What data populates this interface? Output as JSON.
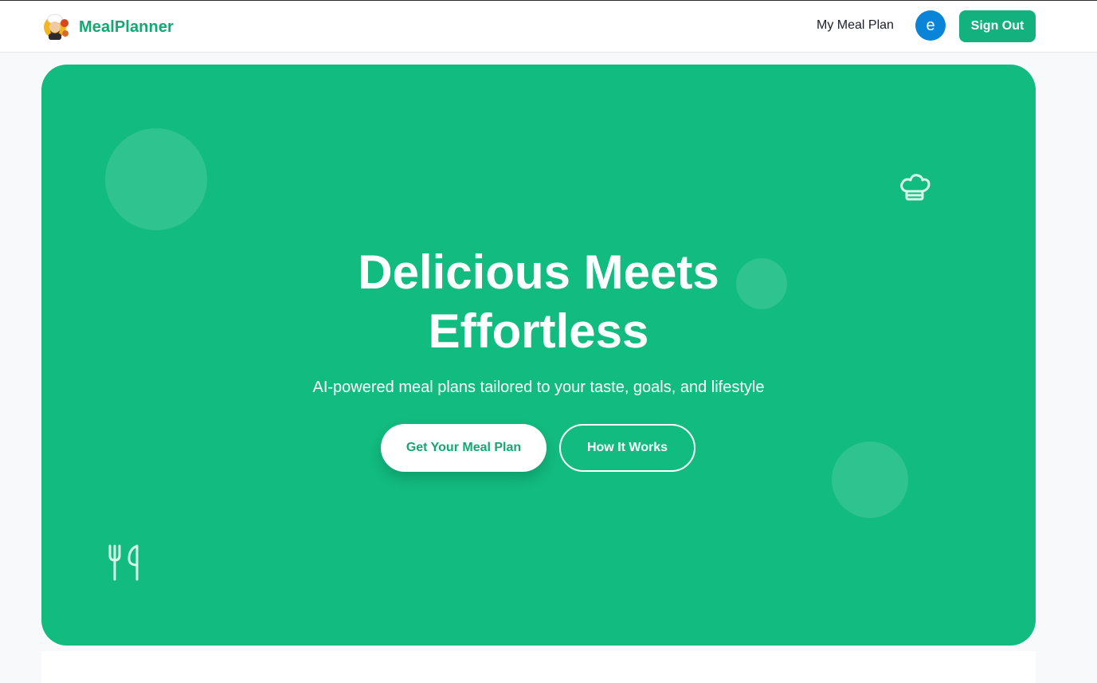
{
  "navbar": {
    "brand_name": "MealPlanner",
    "logo_icon": "chef-mascot-logo",
    "my_meal_plan_label": "My Meal Plan",
    "avatar_initial": "e",
    "sign_out_label": "Sign Out"
  },
  "hero": {
    "title_line1": "Delicious Meets",
    "title_line2": "Effortless",
    "subtitle": "AI-powered meal plans tailored to your taste, goals, and lifestyle",
    "primary_button_label": "Get Your Meal Plan",
    "secondary_button_label": "How It Works",
    "icons": [
      "chef-hat-icon",
      "utensils-icon"
    ]
  },
  "colors": {
    "brand_green": "#13a872",
    "hero_green": "#12bb80",
    "avatar_blue": "#0a84d6",
    "page_bg": "#f8f9fb"
  }
}
